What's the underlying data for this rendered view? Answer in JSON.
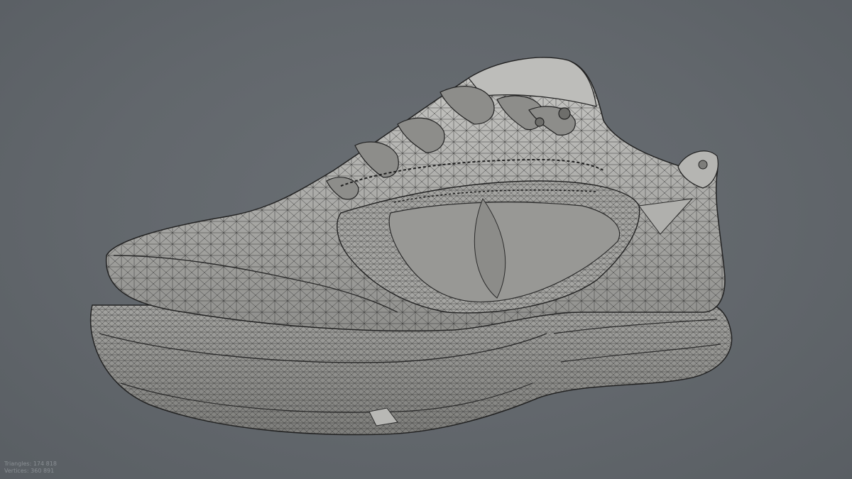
{
  "viewport": {
    "background_color": "#62676c",
    "mesh_fill_color": "#9a9a98",
    "mesh_wire_color": "#2a2a2a",
    "model_icon": "sneaker-mesh-icon"
  },
  "stats": {
    "triangles_label": "Triangles:",
    "triangles_value": "174 818",
    "vertices_label": "Vertices:",
    "vertices_value": "360 891"
  }
}
